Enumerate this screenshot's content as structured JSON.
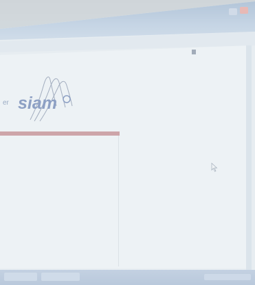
{
  "browser": {
    "address_text": "",
    "search_placeholder": "",
    "window_controls": [
      "minimize-icon",
      "maximize-icon",
      "close-icon"
    ]
  },
  "page": {
    "top_nav_text": "",
    "logo_prefix": "er",
    "logo_text": "siam",
    "body_lines": [
      "",
      "",
      "",
      "",
      ""
    ]
  },
  "taskbar": {
    "task_1": "",
    "task_2": "",
    "tray": ""
  },
  "colors": {
    "accent_bar": "#c38d90",
    "logo_blue": "#6e86b5"
  }
}
